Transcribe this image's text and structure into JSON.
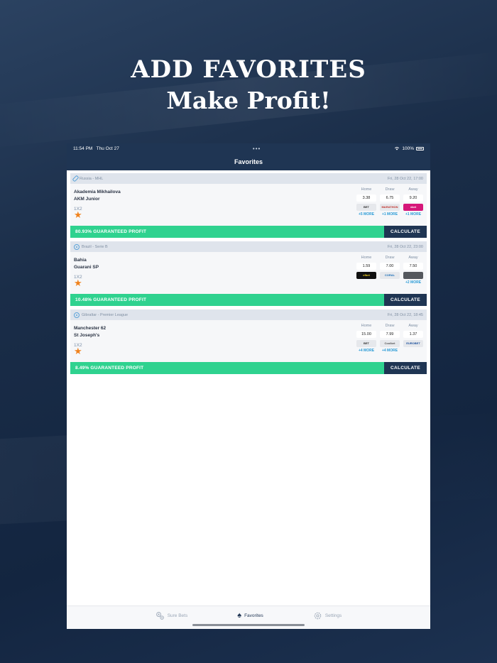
{
  "promo": {
    "line1": "ADD FAVORITES",
    "line2": "Make Profit!"
  },
  "status": {
    "time": "11:54 PM",
    "date": "Thu Oct 27",
    "dots": "•••",
    "battery": "100%"
  },
  "nav": {
    "title": "Favorites"
  },
  "cards": [
    {
      "league": "Russia - MHL",
      "datetime": "Fri, 28 Oct 22, 17:00",
      "team1": "Akademia Mikhailova",
      "team2": "AKM Junior",
      "market": "1X2",
      "odds": [
        {
          "label": "Home",
          "value": "3.38",
          "bookmaker": "BET",
          "more": "+5 MORE",
          "bk_color": "#e6e8ec",
          "bk_text": "#333"
        },
        {
          "label": "Draw",
          "value": "6.75",
          "bookmaker": "MARATHON",
          "more": "+1 MORE",
          "bk_color": "#e6e8ec",
          "bk_text": "#c0302a"
        },
        {
          "label": "Away",
          "value": "9.20",
          "bookmaker": "vbet",
          "more": "+1 MORE",
          "bk_color": "#d6177a",
          "bk_text": "#ffffff"
        }
      ],
      "profit": "80.93% GUARANTEED PROFIT",
      "calculate": "CALCULATE"
    },
    {
      "league": "Brazil - Serie B",
      "datetime": "Fri, 28 Oct 22, 23:00",
      "team1": "Bahia",
      "team2": "Guarani SP",
      "market": "1X2",
      "odds": [
        {
          "label": "Home",
          "value": "1.59",
          "bookmaker": "efbet",
          "more": "",
          "bk_color": "#111111",
          "bk_text": "#f4d21f"
        },
        {
          "label": "Draw",
          "value": "7.00",
          "bookmaker": "CORAL",
          "more": "",
          "bk_color": "#e6e8ec",
          "bk_text": "#1b6fb8"
        },
        {
          "label": "Away",
          "value": "7.50",
          "bookmaker": "",
          "more": "+2 MORE",
          "bk_color": "#55585e",
          "bk_text": "#ffffff"
        }
      ],
      "profit": "10.48% GUARANTEED PROFIT",
      "calculate": "CALCULATE"
    },
    {
      "league": "Gibraltar - Premier League",
      "datetime": "Fri, 28 Oct 22, 18:45",
      "team1": "Manchester 62",
      "team2": "St Joseph's",
      "market": "1X2",
      "odds": [
        {
          "label": "Home",
          "value": "15.00",
          "bookmaker": "BET",
          "more": "+4 MORE",
          "bk_color": "#e6e8ec",
          "bk_text": "#333"
        },
        {
          "label": "Draw",
          "value": "7.99",
          "bookmaker": "Coolbet",
          "more": "+4 MORE",
          "bk_color": "#e6e8ec",
          "bk_text": "#555"
        },
        {
          "label": "Away",
          "value": "1.37",
          "bookmaker": "EUROBET",
          "more": "",
          "bk_color": "#e6e8ec",
          "bk_text": "#1b4f9c"
        }
      ],
      "profit": "8.49% GUARANTEED PROFIT",
      "calculate": "CALCULATE"
    }
  ],
  "tabs": [
    {
      "label": "Sure Bets",
      "icon": "gears-icon",
      "active": false
    },
    {
      "label": "Favorites",
      "icon": "spade-icon",
      "active": true
    },
    {
      "label": "Settings",
      "icon": "gear-icon",
      "active": false
    }
  ]
}
